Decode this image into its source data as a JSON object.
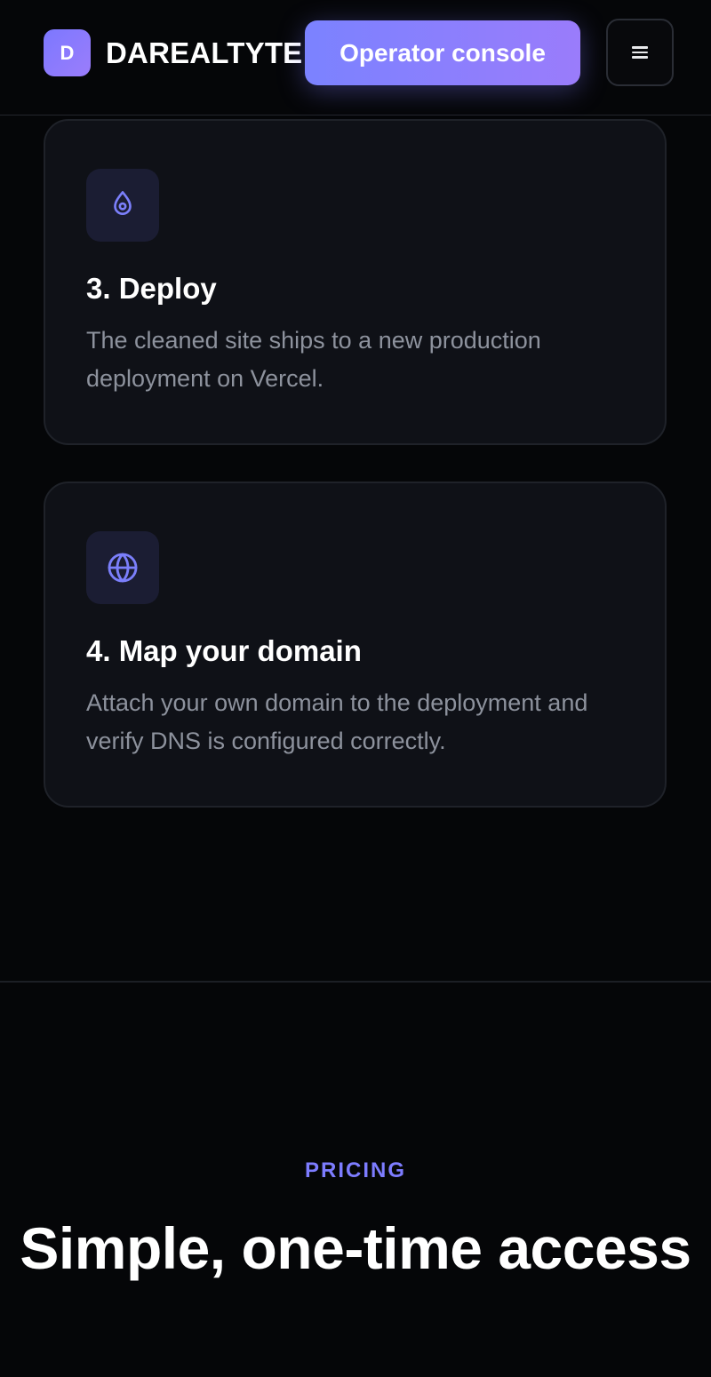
{
  "header": {
    "brand_initial": "D",
    "brand_name": "DAREALTYTE",
    "console_button_label": "Operator console",
    "menu_icon": "hamburger-menu-icon"
  },
  "steps": [
    {
      "icon": "map-pin-icon",
      "title": "3. Deploy",
      "description": "The cleaned site ships to a new production deployment on Vercel."
    },
    {
      "icon": "globe-icon",
      "title": "4. Map your domain",
      "description": "Attach your own domain to the deployment and verify DNS is configured correctly."
    }
  ],
  "pricing": {
    "eyebrow": "PRICING",
    "title": "Simple, one-time access"
  },
  "colors": {
    "accent": "#7d7cff",
    "background": "#050608",
    "card": "#0f1117",
    "muted_text": "#8d929d"
  }
}
